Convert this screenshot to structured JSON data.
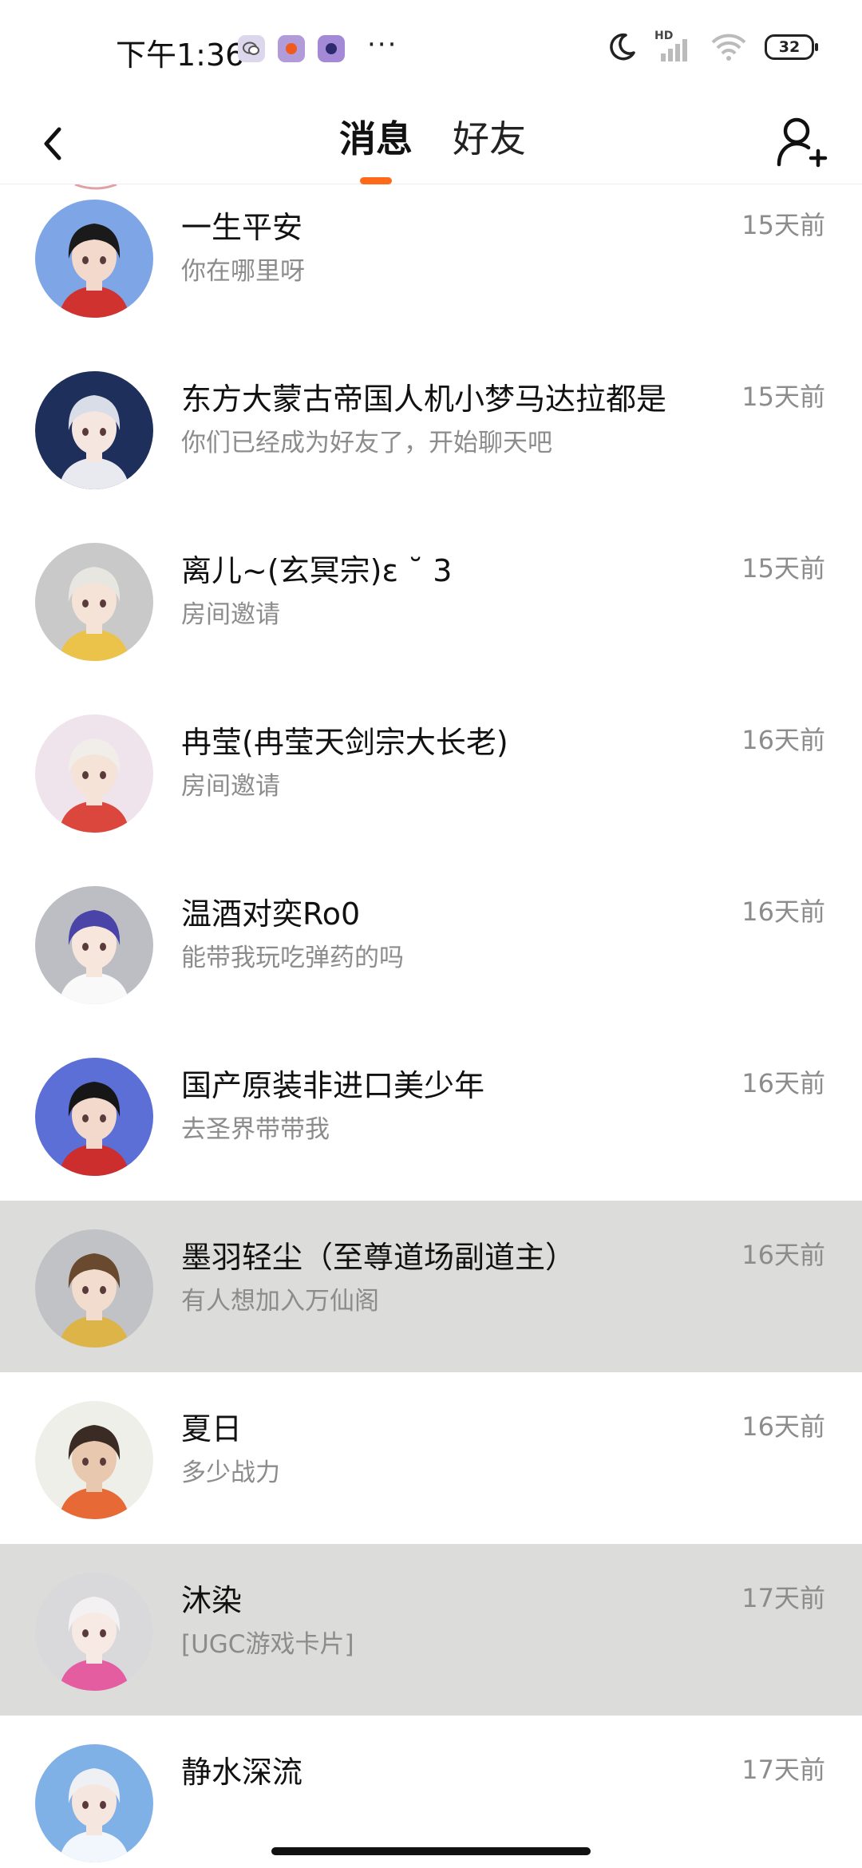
{
  "status_bar": {
    "time": "下午1:36",
    "more": "···",
    "battery": "32",
    "network_label": "HD",
    "icons": [
      "wechat-icon",
      "app-icon-orange",
      "app-icon-purple",
      "moon-icon",
      "signal-icon",
      "wifi-icon",
      "battery-icon"
    ]
  },
  "header": {
    "tabs": [
      {
        "label": "消息",
        "active": true
      },
      {
        "label": "好友",
        "active": false
      }
    ],
    "accent_color": "#ff6a1a"
  },
  "conversations": [
    {
      "name": "一生平安",
      "preview": "你在哪里呀",
      "time": "15天前",
      "highlighted": false,
      "avatar": {
        "bg": "#7ea6e6",
        "hair": "#1a1a1a",
        "skin": "#f2d9cc",
        "accent": "#d8261b"
      }
    },
    {
      "name": "东方大蒙古帝国人机小梦马达拉都是",
      "preview": "你们已经成为好友了，开始聊天吧",
      "time": "15天前",
      "highlighted": false,
      "avatar": {
        "bg": "#1d2f5a",
        "hair": "#d9dde8",
        "skin": "#f5e6e0",
        "accent": "#ffffff"
      }
    },
    {
      "name": "离儿~(玄冥宗)ε ˘ 3",
      "preview": "房间邀请",
      "time": "15天前",
      "highlighted": false,
      "avatar": {
        "bg": "#c9c9c9",
        "hair": "#e8e6e0",
        "skin": "#f4e3d6",
        "accent": "#f0c23c"
      }
    },
    {
      "name": "冉莹(冉莹天剑宗大长老)",
      "preview": "房间邀请",
      "time": "16天前",
      "highlighted": false,
      "avatar": {
        "bg": "#efe3ec",
        "hair": "#f1eee9",
        "skin": "#f4e3d6",
        "accent": "#d9352a"
      }
    },
    {
      "name": "温酒对奕Ro0",
      "preview": "能带我玩吃弹药的吗",
      "time": "16天前",
      "highlighted": false,
      "avatar": {
        "bg": "#bcbec4",
        "hair": "#4a43a8",
        "skin": "#f6e6dc",
        "accent": "#ffffff"
      }
    },
    {
      "name": "国产原装非进口美少年",
      "preview": "去圣界带带我",
      "time": "16天前",
      "highlighted": false,
      "avatar": {
        "bg": "#5b6fd6",
        "hair": "#161616",
        "skin": "#f2d9cc",
        "accent": "#d8261b"
      }
    },
    {
      "name": "墨羽轻尘（至尊道场副道主）",
      "preview": "有人想加入万仙阁",
      "time": "16天前",
      "highlighted": true,
      "avatar": {
        "bg": "#c0c2c6",
        "hair": "#6a4a2e",
        "skin": "#f2dccd",
        "accent": "#e0b23a"
      }
    },
    {
      "name": "夏日",
      "preview": "多少战力",
      "time": "16天前",
      "highlighted": false,
      "avatar": {
        "bg": "#efefe9",
        "hair": "#3a2c24",
        "skin": "#e8c9b0",
        "accent": "#e45a22"
      }
    },
    {
      "name": "沐染",
      "preview": "[UGC游戏卡片]",
      "time": "17天前",
      "highlighted": true,
      "avatar": {
        "bg": "#d9d9dc",
        "hair": "#f3f1f2",
        "skin": "#f7e9e4",
        "accent": "#e44f9a"
      }
    },
    {
      "name": "静水深流",
      "preview": "",
      "time": "17天前",
      "highlighted": false,
      "avatar": {
        "bg": "#7fb0e6",
        "hair": "#eef0f4",
        "skin": "#f5e6e0",
        "accent": "#ffffff"
      }
    }
  ]
}
